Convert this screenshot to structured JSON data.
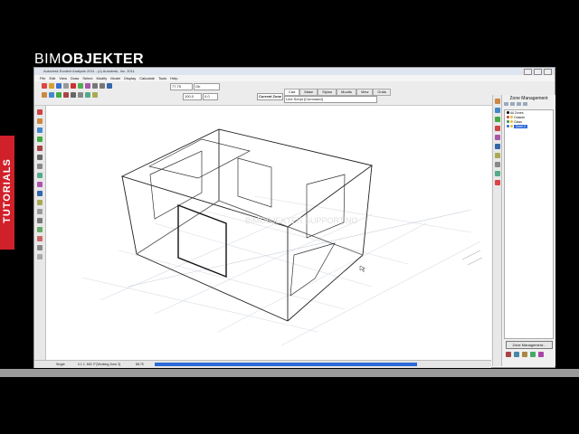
{
  "brand": {
    "part1": "BIM",
    "part2": "OBJEKTER"
  },
  "side_tab": {
    "label": "TUTORIALS"
  },
  "app": {
    "title": "Autodesk Ecotect Analysis 2011 - (c) Autodesk, Inc. 2011",
    "menu": [
      "File",
      "Edit",
      "View",
      "Draw",
      "Select",
      "Modify",
      "Model",
      "Display",
      "Calculate",
      "Tools",
      "Help"
    ],
    "fields": {
      "zoom": "77.75",
      "units": "Ob",
      "snap": "100.0",
      "angle": "0.0"
    },
    "cmd_tabs": [
      "Cad",
      "Make",
      "Stylus",
      "Moults",
      "View",
      "Grids"
    ],
    "cmd_label": "Line Script [Command]",
    "current_zone_label": "Current Zone"
  },
  "zone_panel": {
    "title": "Zone Management",
    "zones": [
      {
        "name": "All Zones",
        "color": "#000000"
      },
      {
        "name": "Outside",
        "color": "#d04040"
      },
      {
        "name": "Glass",
        "color": "#3a8a3a"
      },
      {
        "name": "Zone 2",
        "color": "#2d6ad8"
      }
    ],
    "selected_index": 3,
    "button": "Zone Management..."
  },
  "status": {
    "mode": "Single",
    "info": "0.1   1.  MO: P   [Working Zone 2]",
    "value": "88.75",
    "progress": 1.0
  },
  "canvas": {
    "watermark": "BIMOBJEKTER  SUPPORT.NO"
  },
  "colors": {
    "accent_red": "#d0202a",
    "selection_blue": "#2d6ad8"
  }
}
